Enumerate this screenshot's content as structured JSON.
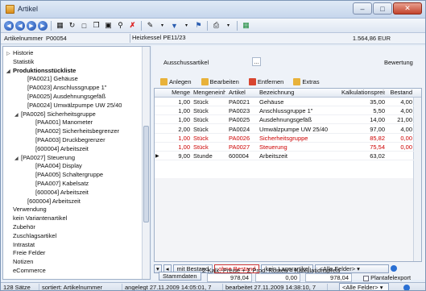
{
  "window": {
    "title": "Artikel",
    "buttons": {
      "minimize": "‒",
      "maximize": "□",
      "close": "✕"
    }
  },
  "toolbar": {
    "icons": [
      "first-icon",
      "prev-icon",
      "next-icon",
      "last-icon",
      "grid-view-icon",
      "refresh-icon",
      "new-icon",
      "copy-icon",
      "save-icon",
      "search-icon",
      "delete-icon",
      "tools-icon",
      "filter-icon",
      "bookmark-icon",
      "print-icon",
      "export-icon"
    ]
  },
  "header": {
    "artikelnummer_label": "Artikelnummer",
    "artikelnummer_value": "P00054",
    "bezeichnung_value": "Heizkessel PE11/23",
    "price_value": "1.564,86",
    "currency": "EUR"
  },
  "tree": {
    "items": [
      {
        "label": "Historie",
        "indent": 0,
        "toggle": "▷"
      },
      {
        "label": "Statistik",
        "indent": 0,
        "toggle": ""
      },
      {
        "label": "Produktionsstückliste",
        "indent": 0,
        "toggle": "◢",
        "selected": true
      },
      {
        "label": "[PA0021] Gehäuse",
        "indent": 2,
        "toggle": ""
      },
      {
        "label": "[PA0023] Anschlussgruppe 1\"",
        "indent": 2,
        "toggle": ""
      },
      {
        "label": "[PA0025] Ausdehnungsgefäß",
        "indent": 2,
        "toggle": ""
      },
      {
        "label": "[PA0024] Umwälzpumpe UW 25/40",
        "indent": 2,
        "toggle": ""
      },
      {
        "label": "[PA0026] Sicherheitsgruppe",
        "indent": 1,
        "toggle": "◢"
      },
      {
        "label": "[PAA001] Manometer",
        "indent": 3,
        "toggle": ""
      },
      {
        "label": "[PAA002] Sicherheitsbegrenzer",
        "indent": 3,
        "toggle": ""
      },
      {
        "label": "[PAA003] Druckbegrenzer",
        "indent": 3,
        "toggle": ""
      },
      {
        "label": "[600004] Arbeitszeit",
        "indent": 3,
        "toggle": ""
      },
      {
        "label": "[PA0027] Steuerung",
        "indent": 1,
        "toggle": "◢"
      },
      {
        "label": "[PAA004] Display",
        "indent": 3,
        "toggle": ""
      },
      {
        "label": "[PAA005] Schaltergruppe",
        "indent": 3,
        "toggle": ""
      },
      {
        "label": "[PAA007] Kabelsatz",
        "indent": 3,
        "toggle": ""
      },
      {
        "label": "[600004] Arbeitszeit",
        "indent": 3,
        "toggle": ""
      },
      {
        "label": "[600004] Arbeitszeit",
        "indent": 2,
        "toggle": ""
      },
      {
        "label": "Verwendung",
        "indent": 0,
        "toggle": ""
      },
      {
        "label": "kein Variantenartikel",
        "indent": 0,
        "toggle": ""
      },
      {
        "label": "Zubehör",
        "indent": 0,
        "toggle": ""
      },
      {
        "label": "Zuschlagsartikel",
        "indent": 0,
        "toggle": ""
      },
      {
        "label": "Intrastat",
        "indent": 0,
        "toggle": ""
      },
      {
        "label": "Freie Felder",
        "indent": 0,
        "toggle": ""
      },
      {
        "label": "Notizen",
        "indent": 0,
        "toggle": ""
      },
      {
        "label": "eCommerce",
        "indent": 0,
        "toggle": ""
      }
    ]
  },
  "right": {
    "ausschussartikel_label": "Ausschussartikel",
    "ausschuss_button": "...",
    "bewertung_label": "Bewertung",
    "actions": [
      {
        "label": "Anlegen",
        "icon": "add-icon",
        "color": "#e8b23a"
      },
      {
        "label": "Bearbeiten",
        "icon": "edit-icon",
        "color": "#e8b23a"
      },
      {
        "label": "Entfernen",
        "icon": "remove-icon",
        "color": "#d8452f"
      },
      {
        "label": "Extras",
        "icon": "extras-icon",
        "color": "#e8b23a"
      }
    ],
    "columns": [
      "Menge",
      "Mengeneinh",
      "Artikel",
      "Bezeichnung",
      "Kalkulationspreis",
      "Bestand"
    ],
    "rows": [
      {
        "menge": "1,00",
        "einheit": "Stück",
        "artikel": "PA0021",
        "bez": "Gehäuse",
        "preis": "35,00",
        "bestand": "4,00",
        "red": false,
        "marker": ""
      },
      {
        "menge": "1,00",
        "einheit": "Stück",
        "artikel": "PA0023",
        "bez": "Anschlussgruppe 1\"",
        "preis": "5,50",
        "bestand": "4,00",
        "red": false,
        "marker": ""
      },
      {
        "menge": "1,00",
        "einheit": "Stück",
        "artikel": "PA0025",
        "bez": "Ausdehnungsgefäß",
        "preis": "14,00",
        "bestand": "21,00",
        "red": false,
        "marker": ""
      },
      {
        "menge": "2,00",
        "einheit": "Stück",
        "artikel": "PA0024",
        "bez": "Umwälzpumpe UW 25/40",
        "preis": "97,00",
        "bestand": "4,00",
        "red": false,
        "marker": ""
      },
      {
        "menge": "1,00",
        "einheit": "Stück",
        "artikel": "PA0026",
        "bez": "Sicherheitsgruppe",
        "preis": "85,82",
        "bestand": "0,00",
        "red": true,
        "marker": ""
      },
      {
        "menge": "1,00",
        "einheit": "Stück",
        "artikel": "PA0027",
        "bez": "Steuerung",
        "preis": "75,54",
        "bestand": "0,00",
        "red": true,
        "marker": ""
      },
      {
        "menge": "9,00",
        "einheit": "Stunde",
        "artikel": "600004",
        "bez": "Arbeitszeit",
        "preis": "63,02",
        "bestand": "",
        "red": false,
        "marker": "▶"
      }
    ],
    "filters": {
      "mit_bestand": "mit Bestand",
      "ohne_bestand": "ohne Bestand",
      "kein_lagerartikel": "kein Lagerartikel",
      "alle_felder": "<Alle Felder>",
      "dropdown": "▾"
    },
    "formula": {
      "line": "Σ Kalk.-Preise  +  Σ Prod.-Kosten  =  Kalkulationspreis",
      "stammdaten": "Stammdaten",
      "v1": "978,04",
      "v2": "0,00",
      "v3": "978,04",
      "plantafelexport": "Plantafelexport"
    }
  },
  "status": {
    "count": "128 Sätze",
    "sort": "sortiert: Artikelnummer",
    "angelegt": "angelegt 27.11.2009 14:05:01,  7",
    "bearbeitet": "bearbeitet 27.11.2009 14:38:10,  7",
    "alle_felder": "<Alle Felder>",
    "dropdown": "▾"
  }
}
